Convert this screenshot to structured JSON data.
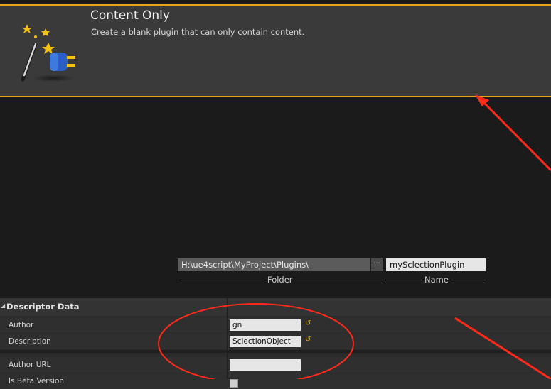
{
  "template": {
    "title": "Content Only",
    "description": "Create a blank plugin that can only contain content.",
    "icon": "magic-wand-plug-icon"
  },
  "paths": {
    "folder_value": "H:\\ue4script\\MyProject\\Plugins\\",
    "browse_label": "···",
    "folder_caption": "Folder",
    "name_value": "mySclectionPlugin",
    "name_caption": "Name"
  },
  "descriptor": {
    "header": "Descriptor Data",
    "rows": [
      {
        "label": "Author",
        "value": "gn"
      },
      {
        "label": "Description",
        "value": "SclectionObject"
      },
      {
        "label": "Author URL",
        "value": ""
      },
      {
        "label": "Is Beta Version",
        "value": ""
      }
    ]
  },
  "colors": {
    "accent": "#e8a317",
    "annotation": "#ff2a1a",
    "reset": "#e8c11a"
  }
}
